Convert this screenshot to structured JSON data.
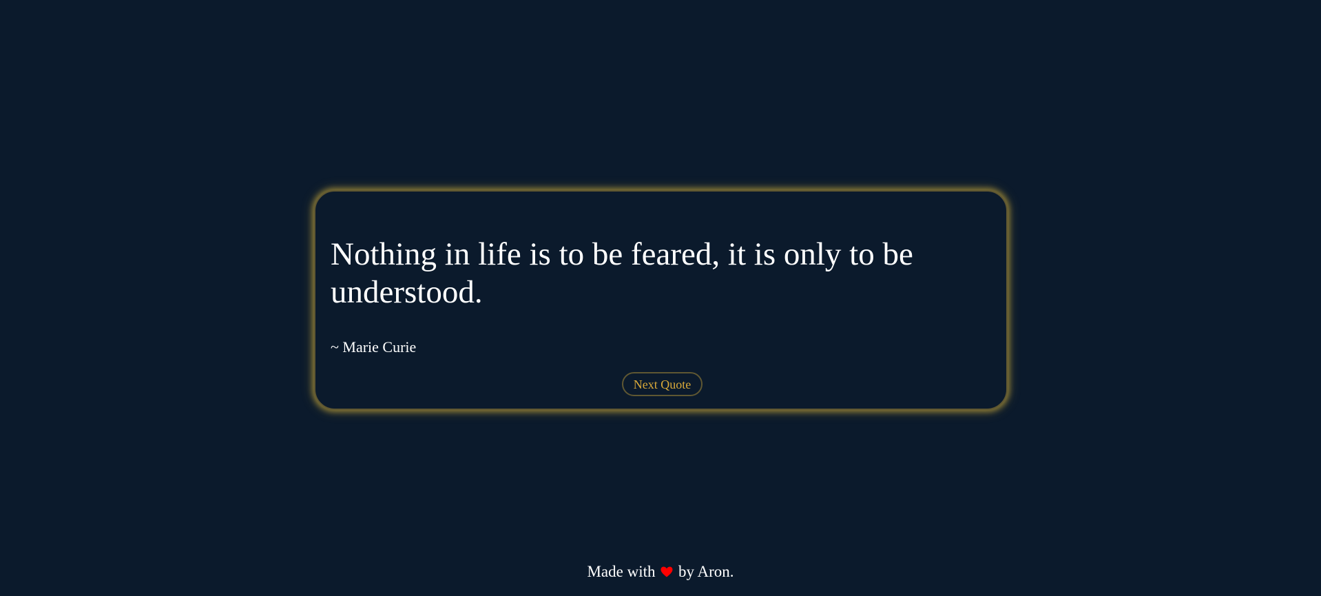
{
  "quote": {
    "text": "Nothing in life is to be feared, it is only to be understood.",
    "author": "~ Marie Curie",
    "next_button_label": "Next Quote"
  },
  "footer": {
    "prefix": "Made with",
    "icon": "heart-icon",
    "suffix": "by Aron."
  },
  "colors": {
    "background": "#0b1a2c",
    "accent": "#d9a93a",
    "glow": "#d6b23a",
    "heart": "#ff0000",
    "text": "#ffffff"
  }
}
